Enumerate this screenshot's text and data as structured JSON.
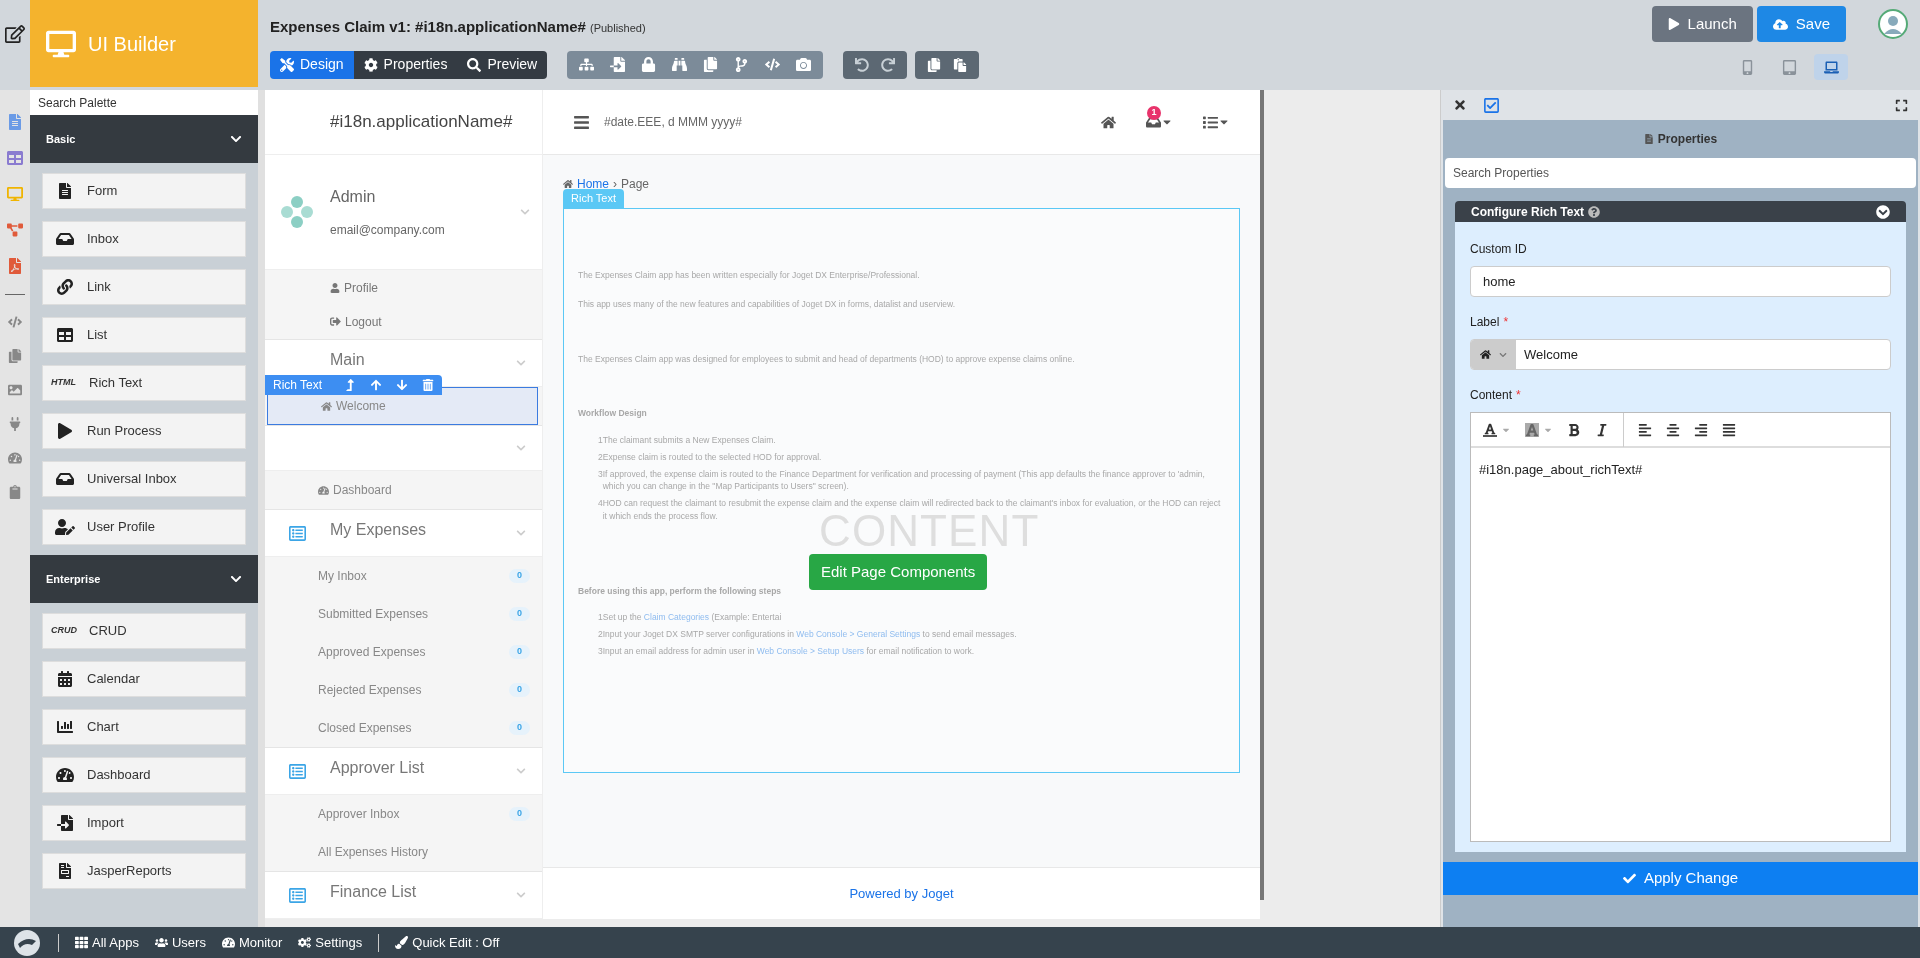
{
  "header": {
    "logo_text": "UI Builder",
    "title": "Expenses Claim v1: #i18n.applicationName#",
    "status": "(Published)",
    "mode_tabs": [
      {
        "label": "Design",
        "selected": true
      },
      {
        "label": "Properties",
        "selected": false
      },
      {
        "label": "Preview",
        "selected": false
      }
    ],
    "actions": [
      {
        "label": "Launch",
        "kind": "secondary"
      },
      {
        "label": "Save",
        "kind": "primary"
      }
    ],
    "devices": [
      {
        "selected": false
      },
      {
        "selected": false
      },
      {
        "selected": true
      }
    ]
  },
  "palette": {
    "search_placeholder": "Search Palette",
    "groups": [
      {
        "title": "Basic",
        "expanded": true,
        "items": [
          {
            "label": "Form"
          },
          {
            "label": "Inbox"
          },
          {
            "label": "Link"
          },
          {
            "label": "List"
          },
          {
            "label": "Rich Text",
            "icon_text": "HTML"
          },
          {
            "label": "Run Process"
          },
          {
            "label": "Universal Inbox"
          },
          {
            "label": "User Profile"
          }
        ]
      },
      {
        "title": "Enterprise",
        "expanded": true,
        "items": [
          {
            "label": "CRUD",
            "icon_text": "CRUD"
          },
          {
            "label": "Calendar"
          },
          {
            "label": "Chart"
          },
          {
            "label": "Dashboard"
          },
          {
            "label": "Import"
          },
          {
            "label": "JasperReports"
          }
        ]
      }
    ]
  },
  "userview": {
    "app_name": "#i18n.applicationName#",
    "date": "#date.EEE, d MMM yyyy#",
    "notification_count": "1",
    "profile": {
      "name": "Admin",
      "email": "email@company.com",
      "links": [
        "Profile",
        "Logout"
      ]
    },
    "selection_toolbar": "Rich Text",
    "categories": [
      {
        "title": "Main",
        "has_icon": false,
        "items": [
          {
            "label": "Welcome",
            "selected": true
          }
        ]
      },
      {
        "has_icon": false,
        "items": [
          {
            "label": "Dashboard",
            "selected": false
          }
        ]
      },
      {
        "title": "My Expenses",
        "has_icon": true,
        "items": [
          {
            "label": "My Inbox",
            "count": "0",
            "selected": false
          },
          {
            "label": "Submitted Expenses",
            "count": "0",
            "selected": false
          },
          {
            "label": "Approved Expenses",
            "count": "0",
            "selected": false
          },
          {
            "label": "Rejected Expenses",
            "count": "0",
            "selected": false
          },
          {
            "label": "Closed Expenses",
            "count": "0",
            "selected": false
          }
        ]
      },
      {
        "title": "Approver List",
        "has_icon": true,
        "items": [
          {
            "label": "Approver Inbox",
            "count": "0",
            "selected": false
          },
          {
            "label": "All Expenses History",
            "selected": false
          }
        ]
      },
      {
        "title": "Finance List",
        "has_icon": true
      }
    ],
    "breadcrumb": {
      "home": "Home",
      "separator": "›",
      "current": "Page"
    },
    "content": {
      "tag": "Rich Text",
      "paragraphs": [
        "The Expenses Claim app has been written especially for Joget DX Enterprise/Professional.",
        "This app uses many of the new features and capabilities of Joget DX in forms, datalist and userview.",
        "The Expenses Claim app was designed for employees to submit and head of departments (HOD) to approve expense claims online."
      ],
      "workflow_heading": "Workflow Design",
      "workflow_steps": [
        {
          "number": "1",
          "text": "The claimant submits a New Expenses Claim."
        },
        {
          "number": "2",
          "text": "Expense claim is routed to the selected HOD for approval."
        },
        {
          "number": "3",
          "text": "If approved, the expense claim is routed to the Finance Department for verification and processing of payment (This app defaults the finance approver to 'admin, which you can change in the \"Map Participants to Users\" screen)."
        },
        {
          "number": "4",
          "text": "HOD can request the claimant to resubmit the expense claim and the expense claim will redirected back to the claimant's inbox for evaluation, or the HOD can reject it which ends the process flow."
        }
      ],
      "setup_heading": "Before using this app, perform the following steps",
      "setup_steps": [
        {
          "number": "1",
          "parts": [
            {
              "text": "Set up the "
            },
            {
              "text": "Claim Categories",
              "link": true
            },
            {
              "text": " (Example: Entertai"
            }
          ]
        },
        {
          "number": "2",
          "parts": [
            {
              "text": "Input your Joget DX SMTP server configurations in "
            },
            {
              "text": "Web Console > General Settings",
              "link": true
            },
            {
              "text": " to send email messages."
            }
          ]
        },
        {
          "number": "3",
          "parts": [
            {
              "text": "Input an email address for admin user in "
            },
            {
              "text": "Web Console > Setup Users",
              "link": true
            },
            {
              "text": " for email notification to work."
            }
          ]
        }
      ],
      "watermark": "CONTENT",
      "edit_button": "Edit Page Components"
    },
    "footer": "Powered by Joget"
  },
  "properties_panel": {
    "title": "Properties",
    "search_placeholder": "Search Properties",
    "section": {
      "title": "Configure Rich Text",
      "expanded": true
    },
    "required_mark": "*",
    "fields": [
      {
        "kind": "text",
        "label": "Custom ID",
        "required": false,
        "value": "home"
      },
      {
        "kind": "icon_text",
        "label": "Label",
        "required": true,
        "value": "Welcome"
      },
      {
        "kind": "richtext",
        "label": "Content",
        "required": true,
        "value": "#i18n.page_about_richText#"
      }
    ],
    "apply_button": "Apply Change"
  },
  "status_bar": {
    "links": [
      "All Apps",
      "Users",
      "Monitor",
      "Settings"
    ],
    "quick_edit": "Quick Edit : Off"
  }
}
